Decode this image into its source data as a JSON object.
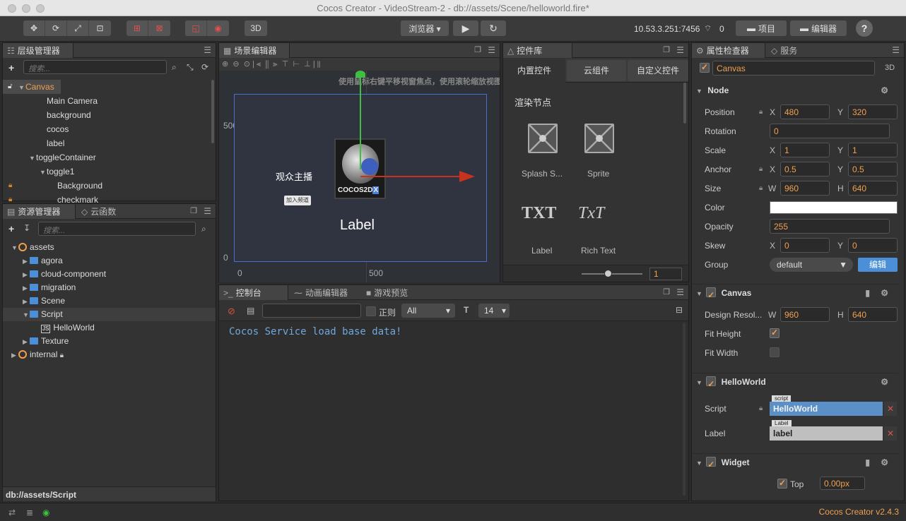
{
  "window": {
    "title": "Cocos Creator - VideoStream-2 - db://assets/Scene/helloworld.fire*"
  },
  "toolbar": {
    "view_3d": "3D",
    "browser_label": "浏览器 ▾",
    "play_icon": "▶",
    "refresh_icon": "↻",
    "ip": "10.53.3.251:7456",
    "connections": "0",
    "project_btn": "项目",
    "editor_btn": "编辑器",
    "help": "?"
  },
  "hierarchy": {
    "title": "层级管理器",
    "search_placeholder": "搜索...",
    "nodes": [
      {
        "label": "Canvas",
        "indent": 0
      },
      {
        "label": "Main Camera",
        "indent": 2
      },
      {
        "label": "background",
        "indent": 2
      },
      {
        "label": "cocos",
        "indent": 2
      },
      {
        "label": "label",
        "indent": 2
      },
      {
        "label": "toggleContainer",
        "indent": 1
      },
      {
        "label": "toggle1",
        "indent": 2
      },
      {
        "label": "Background",
        "indent": 3
      },
      {
        "label": "checkmark",
        "indent": 3
      }
    ]
  },
  "assets": {
    "title": "资源管理器",
    "tab2": "云函数",
    "search_placeholder": "搜索...",
    "items": [
      {
        "label": "assets"
      },
      {
        "label": "agora"
      },
      {
        "label": "cloud-component"
      },
      {
        "label": "migration"
      },
      {
        "label": "Scene"
      },
      {
        "label": "Script"
      },
      {
        "label": "HelloWorld"
      },
      {
        "label": "Texture"
      },
      {
        "label": "internal"
      }
    ],
    "footer_path": "db://assets/Script"
  },
  "scene": {
    "title": "场景编辑器",
    "hint": "使用鼠标右键平移视窗焦点，使用滚轮缩放视图",
    "ruler_y_500": "500",
    "ruler_y_0": "0",
    "ruler_x_0": "0",
    "ruler_x_500": "500",
    "anchor_text": "观众主播",
    "join_button": "加入频道",
    "logo_text": "COCOS2D",
    "logo_badge": "X",
    "label_text": "Label"
  },
  "widgets": {
    "title": "控件库",
    "tabs": [
      "内置控件",
      "云组件",
      "自定义控件"
    ],
    "section": "渲染节点",
    "items": [
      {
        "label": "Splash S...",
        "icon": "splash-sprite-icon"
      },
      {
        "label": "Sprite",
        "icon": "sprite-icon"
      },
      {
        "label": "Label",
        "glyph": "TXT"
      },
      {
        "label": "Rich Text",
        "glyph": "TxT"
      }
    ],
    "zoom_value": "1"
  },
  "console": {
    "tabs": [
      "控制台",
      "动画编辑器",
      "游戏预览"
    ],
    "regex_label": "正则",
    "level": "All",
    "font_size": "14",
    "log": "Cocos Service load base data!"
  },
  "inspector": {
    "title": "属性检查器",
    "tab2": "服务",
    "node_name": "Canvas",
    "mode_3d": "3D",
    "sections": {
      "node": "Node",
      "canvas": "Canvas",
      "helloworld": "HelloWorld",
      "widget": "Widget"
    },
    "labels": {
      "position": "Position",
      "rotation": "Rotation",
      "scale": "Scale",
      "anchor": "Anchor",
      "size": "Size",
      "color": "Color",
      "opacity": "Opacity",
      "skew": "Skew",
      "group": "Group",
      "design_resolution": "Design Resol...",
      "fit_height": "Fit Height",
      "fit_width": "Fit Width",
      "script": "Script",
      "label": "Label",
      "top": "Top"
    },
    "axes": {
      "x": "X",
      "y": "Y",
      "w": "W",
      "h": "H"
    },
    "values": {
      "pos_x": "480",
      "pos_y": "320",
      "rotation": "0",
      "scale_x": "1",
      "scale_y": "1",
      "anchor_x": "0.5",
      "anchor_y": "0.5",
      "size_w": "960",
      "size_h": "640",
      "opacity": "255",
      "skew_x": "0",
      "skew_y": "0",
      "group": "default",
      "group_edit": "编辑",
      "design_w": "960",
      "design_h": "640",
      "script_tag": "script",
      "script_value": "HelloWorld",
      "label_tag": "Label",
      "label_value": "label",
      "top_value": "0.00px"
    }
  },
  "status": {
    "version": "Cocos Creator v2.4.3"
  },
  "colors": {
    "accent": "#f0a050",
    "selection": "#5b8fc7",
    "panel": "#333333"
  }
}
